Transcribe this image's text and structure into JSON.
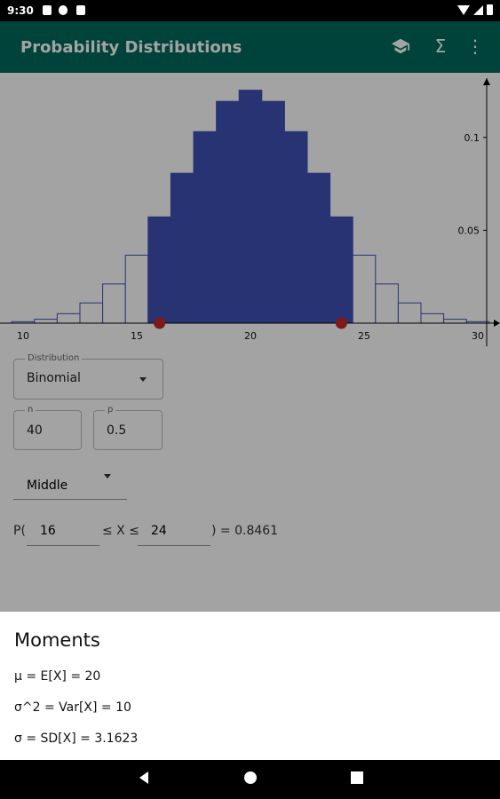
{
  "status": {
    "time": "9:30"
  },
  "appbar": {
    "title": "Probability Distributions",
    "actions": [
      {
        "icon": "school-icon"
      },
      {
        "icon": "sigma-icon",
        "glyph": "Σ"
      },
      {
        "icon": "more-vert-icon",
        "glyph": "⋮"
      }
    ]
  },
  "chart_data": {
    "type": "bar",
    "x_ticks": [
      "10",
      "15",
      "20",
      "25",
      "30"
    ],
    "y_ticks": [
      "0.1",
      "0.05"
    ],
    "xlim": [
      9.5,
      31
    ],
    "ylim": [
      0,
      0.13
    ],
    "categories": [
      10,
      11,
      12,
      13,
      14,
      15,
      16,
      17,
      18,
      19,
      20,
      21,
      22,
      23,
      24,
      25,
      26,
      27,
      28,
      29,
      30
    ],
    "values": [
      0.0008,
      0.0021,
      0.0051,
      0.0109,
      0.0211,
      0.0366,
      0.0572,
      0.0807,
      0.1031,
      0.1194,
      0.1254,
      0.1194,
      0.1031,
      0.0807,
      0.0572,
      0.0366,
      0.0211,
      0.0109,
      0.0051,
      0.0021,
      0.0008
    ],
    "highlight_range": [
      16,
      24
    ],
    "colors": {
      "highlight": "#3f51b5",
      "outline": "#3f51b5",
      "marker": "#c62828",
      "axis": "#000000"
    }
  },
  "form": {
    "distribution_label": "Distribution",
    "distribution_value": "Binomial",
    "n_label": "n",
    "n_value": "40",
    "p_label": "p",
    "p_value": "0.5",
    "type_value": "Middle",
    "prob_prefix": "P(",
    "lower": "16",
    "middle": "≤ X ≤",
    "upper": "24",
    "result": ") = 0.8461"
  },
  "moments": {
    "title": "Moments",
    "mean": "μ = E[X] = 20",
    "variance": "σ^2 = Var[X] = 10",
    "sd": "σ = SD[X] = 3.1623"
  }
}
